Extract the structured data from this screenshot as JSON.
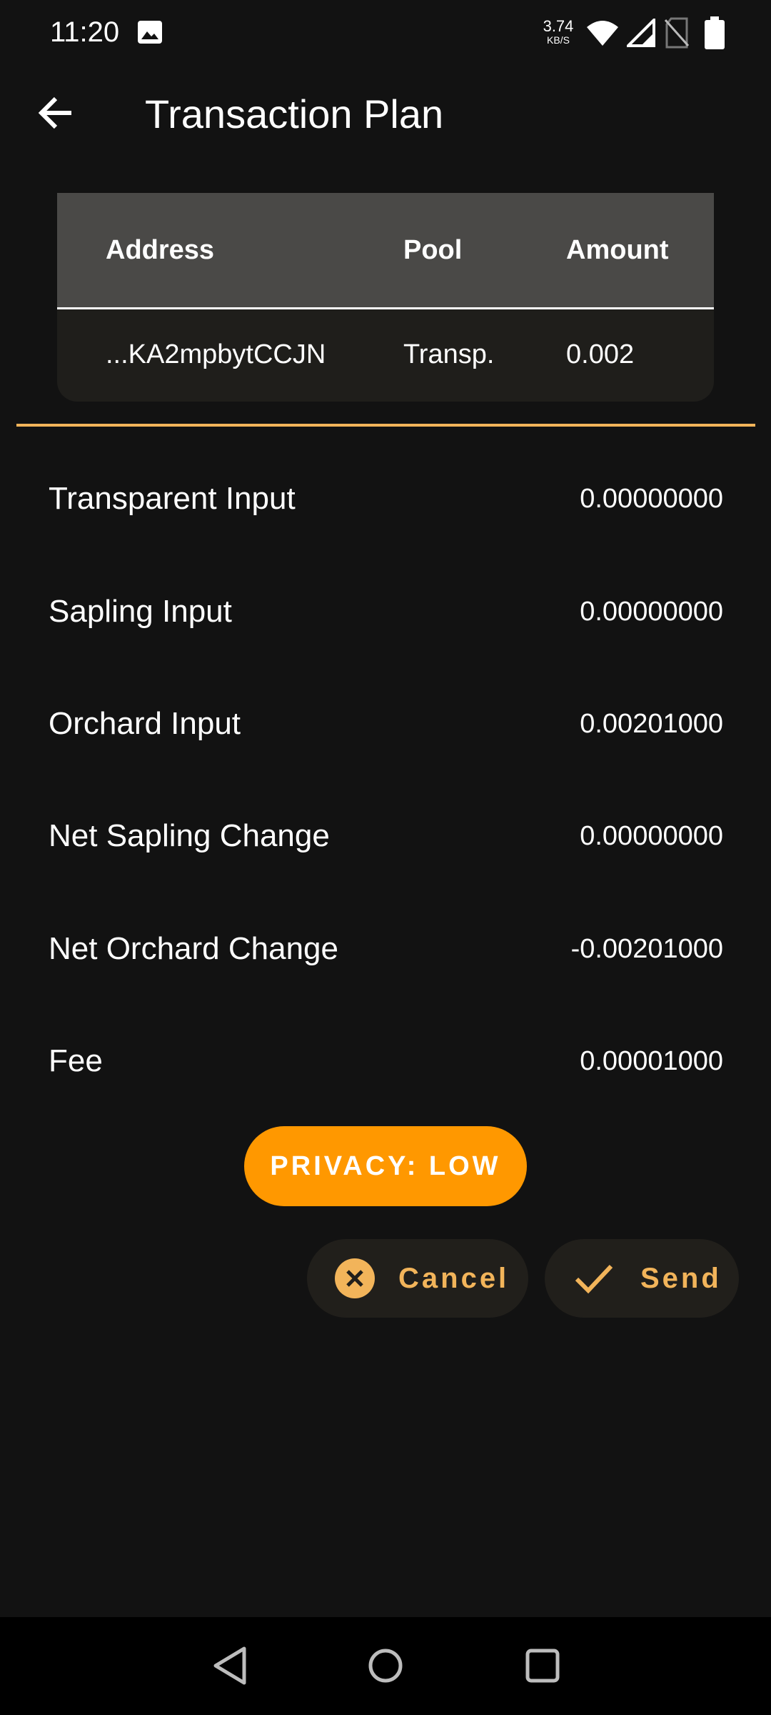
{
  "status_bar": {
    "time": "11:20",
    "net_speed_value": "3.74",
    "net_speed_unit": "KB/S",
    "icons": [
      "image-icon",
      "wifi-icon",
      "signal-icon",
      "no-sim-icon",
      "battery-icon"
    ]
  },
  "app_bar": {
    "title": "Transaction Plan",
    "back_icon": "arrow-left-icon"
  },
  "table": {
    "headers": {
      "address": "Address",
      "pool": "Pool",
      "amount": "Amount"
    },
    "rows": [
      {
        "address": "...KA2mpbytCCJN",
        "pool": "Transp.",
        "amount": "0.002"
      }
    ]
  },
  "summary": [
    {
      "label": "Transparent Input",
      "value": "0.00000000"
    },
    {
      "label": "Sapling Input",
      "value": "0.00000000"
    },
    {
      "label": "Orchard Input",
      "value": "0.00201000"
    },
    {
      "label": "Net Sapling Change",
      "value": "0.00000000"
    },
    {
      "label": "Net Orchard Change",
      "value": "-0.00201000"
    },
    {
      "label": "Fee",
      "value": "0.00001000"
    }
  ],
  "privacy": {
    "label": "PRIVACY: LOW"
  },
  "actions": {
    "cancel_label": "Cancel",
    "cancel_icon": "close-circle-icon",
    "send_label": "Send",
    "send_icon": "check-icon"
  },
  "colors": {
    "background": "#121212",
    "accent": "#f2b45a",
    "privacy_low": "#ff9800",
    "table_header": "#4a4947",
    "card": "#1f1e1b"
  }
}
